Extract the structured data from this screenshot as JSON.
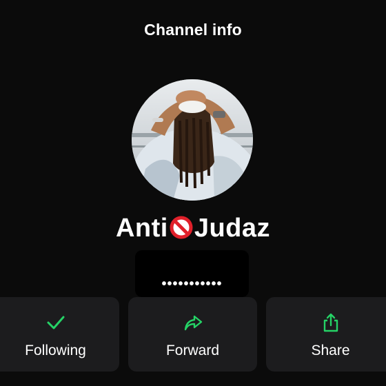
{
  "header": {
    "title": "Channel info"
  },
  "channel": {
    "name_part1": "Anti",
    "name_emoji": "no-entry-sign-icon",
    "name_part2": "Judaz",
    "handle": "•••••••••••"
  },
  "actions": [
    {
      "label": "Following",
      "icon": "checkmark-icon"
    },
    {
      "label": "Forward",
      "icon": "forward-arrow-icon"
    },
    {
      "label": "Share",
      "icon": "share-icon"
    }
  ],
  "colors": {
    "background": "#0b0b0b",
    "card": "#1c1c1e",
    "accent": "#25d366",
    "no_sign": "#e0202a"
  }
}
